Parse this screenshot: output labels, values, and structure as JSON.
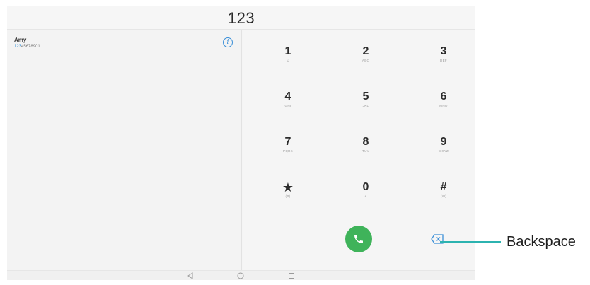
{
  "header": {
    "dialed_number": "123"
  },
  "contact": {
    "name": "Amy",
    "number_match": "123",
    "number_rest": "45678901"
  },
  "keypad": [
    {
      "digit": "1",
      "letters": "ω"
    },
    {
      "digit": "2",
      "letters": "ABC"
    },
    {
      "digit": "3",
      "letters": "DEF"
    },
    {
      "digit": "4",
      "letters": "GHI"
    },
    {
      "digit": "5",
      "letters": "JKL"
    },
    {
      "digit": "6",
      "letters": "MNO"
    },
    {
      "digit": "7",
      "letters": "PQRS"
    },
    {
      "digit": "8",
      "letters": "TUV"
    },
    {
      "digit": "9",
      "letters": "WXYZ"
    },
    {
      "digit": "★",
      "letters": "(P)"
    },
    {
      "digit": "0",
      "letters": "+"
    },
    {
      "digit": "#",
      "letters": "(W)"
    }
  ],
  "callout": {
    "label": "Backspace"
  },
  "colors": {
    "call_green": "#3fb35a",
    "callout_teal": "#2cb3b0",
    "link_blue": "#2a8bd6"
  },
  "icons": {
    "info": "info-circle-icon",
    "call": "phone-icon",
    "backspace": "backspace-icon",
    "nav_back": "triangle-back-icon",
    "nav_home": "circle-home-icon",
    "nav_recent": "square-recent-icon"
  }
}
